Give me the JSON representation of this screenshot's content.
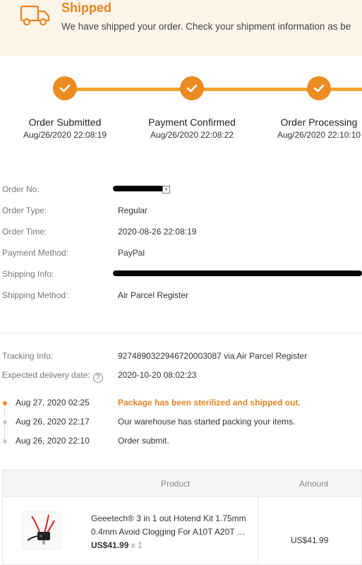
{
  "banner": {
    "title": "Shipped",
    "description": "We have shipped your order. Check your shipment information as be",
    "icon": "truck-icon"
  },
  "progress": {
    "steps": [
      {
        "name": "Order Submitted",
        "time": "Aug/26/2020 22:08:19"
      },
      {
        "name": "Payment Confirmed",
        "time": "Aug/26/2020 22:08:22"
      },
      {
        "name": "Order Processing",
        "time": "Aug/26/2020 22:10:10"
      }
    ]
  },
  "order_info": {
    "order_no_label": "Order No:",
    "order_type_label": "Order Type:",
    "order_type": "Regular",
    "order_time_label": "Order Time:",
    "order_time": "2020-08-26 22:08:19",
    "payment_method_label": "Payment Method:",
    "payment_method": "PayPal",
    "shipping_info_label": "Shipping Info:",
    "shipping_method_label": "Shipping Method:",
    "shipping_method": "Air Parcel Register"
  },
  "tracking": {
    "tracking_label": "Tracking Info:",
    "tracking_value": "9274890322946720003087 via Air Parcel Register",
    "delivery_label": "Expected delivery date:",
    "delivery_value": "2020-10-20 08:02:23",
    "help_glyph": "?",
    "events": [
      {
        "date": "Aug 27, 2020 02:25",
        "message": "Package has been sterilized and shipped out."
      },
      {
        "date": "Aug 26, 2020 22:17",
        "message": "Our warehouse has started packing your items."
      },
      {
        "date": "Aug 26, 2020 22:10",
        "message": "Order submit."
      }
    ]
  },
  "products": {
    "col_product": "Product",
    "col_amount": "Amount",
    "items": [
      {
        "name": "Geeetech® 3 in 1 out Hotend Kit 1.75mm 0.4mm Avoid Clogging For A10T A20T …",
        "price": "US$41.99",
        "qty": "x 1",
        "amount": "US$41.99"
      }
    ]
  },
  "colors": {
    "accent": "#e98420",
    "banner_bg": "#fdf4ea",
    "progress_line": "#f0a531"
  }
}
